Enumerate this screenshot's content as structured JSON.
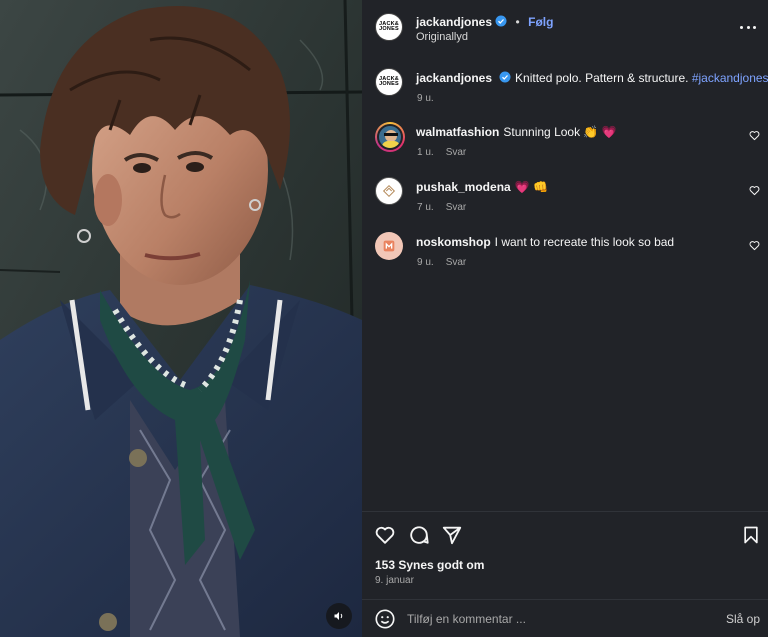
{
  "media": {
    "sound_icon": "speaker-icon"
  },
  "header": {
    "username": "jackandjones",
    "separator": "•",
    "follow_label": "Følg",
    "audio_label": "Originallyd",
    "brand_logo_lines": [
      "JACK&",
      "JONES"
    ],
    "more_icon": "more-dots-icon"
  },
  "caption": {
    "username": "jackandjones",
    "text": "Knitted polo. Pattern & structure.",
    "hashtag": "#jackandjones",
    "time": "9 u."
  },
  "comments": [
    {
      "username": "walmatfashion",
      "text": "Stunning Look 👏 💗",
      "time": "1 u.",
      "reply_label": "Svar"
    },
    {
      "username": "pushak_modena",
      "text": "💗 👊",
      "time": "7 u.",
      "reply_label": "Svar"
    },
    {
      "username": "noskomshop",
      "text": "I want to recreate this look so bad",
      "time": "9 u.",
      "reply_label": "Svar"
    }
  ],
  "actions": {
    "like_icon": "heart-icon",
    "comment_icon": "comment-icon",
    "share_icon": "share-icon",
    "save_icon": "bookmark-icon"
  },
  "likes_text": "153 Synes godt om",
  "date_text": "9. januar",
  "comment_bar": {
    "placeholder": "Tilføj en kommentar ...",
    "post_label": "Slå op",
    "emoji_icon": "emoji-icon"
  },
  "colors": {
    "panel_bg": "#212328",
    "link": "#7ea3ff",
    "verified": "#3897f0",
    "text": "#f5f5f5",
    "muted": "#a8a8a8"
  }
}
